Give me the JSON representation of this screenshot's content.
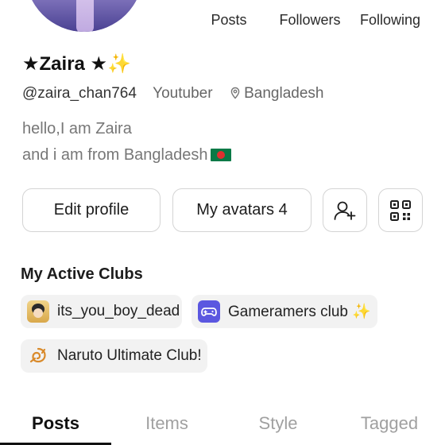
{
  "profile": {
    "name": "★Zaira ★✨",
    "handle": "@zaira_chan764",
    "role": "Youtuber",
    "location": "Bangladesh",
    "bio_line1": "hello,I am Zaira",
    "bio_line2": "and i am from Bangladesh"
  },
  "stats": {
    "posts_label": "Posts",
    "followers_label": "Followers",
    "following_label": "Following"
  },
  "buttons": {
    "edit_profile": "Edit profile",
    "my_avatars": "My avatars 4"
  },
  "clubs": {
    "title": "My Active Clubs",
    "items": [
      {
        "label": "its_you_boy_dead",
        "icon": "anime-boy-icon"
      },
      {
        "label": "Gameramers club ✨",
        "icon": "gamepad-icon"
      },
      {
        "label": "Naruto Ultimate Club!",
        "icon": "leaf-village-icon"
      }
    ]
  },
  "tabs": [
    {
      "label": "Posts",
      "active": true
    },
    {
      "label": "Items",
      "active": false
    },
    {
      "label": "Style",
      "active": false
    },
    {
      "label": "Tagged",
      "active": false
    }
  ],
  "colors": {
    "text_primary": "#1c1c1c",
    "text_muted": "#777777",
    "tab_inactive": "#a0a0a0",
    "chip_bg": "#f2f2f2",
    "border": "#d4d4d4",
    "gamepad_accent": "#5b57e0"
  }
}
